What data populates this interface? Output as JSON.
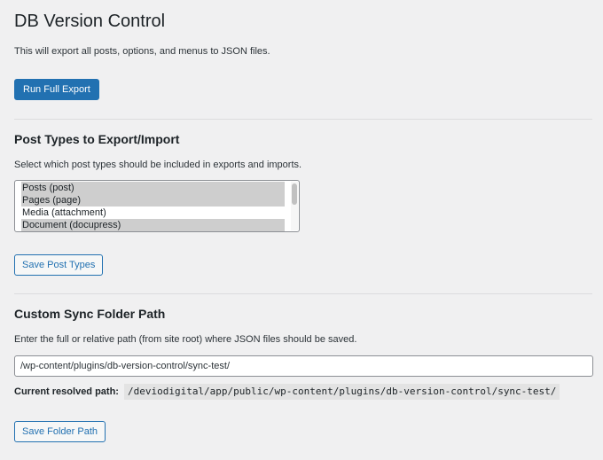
{
  "page": {
    "title": "DB Version Control"
  },
  "export": {
    "description": "This will export all posts, options, and menus to JSON files.",
    "button_label": "Run Full Export"
  },
  "post_types": {
    "heading": "Post Types to Export/Import",
    "description": "Select which post types should be included in exports and imports.",
    "options": [
      {
        "label": "Posts (post)",
        "selected": true
      },
      {
        "label": "Pages (page)",
        "selected": true
      },
      {
        "label": "Media (attachment)",
        "selected": false
      },
      {
        "label": "Document (docupress)",
        "selected": true
      }
    ],
    "save_label": "Save Post Types"
  },
  "sync_folder": {
    "heading": "Custom Sync Folder Path",
    "description": "Enter the full or relative path (from site root) where JSON files should be saved.",
    "input_value": "/wp-content/plugins/db-version-control/sync-test/",
    "resolved_label": "Current resolved path:",
    "resolved_path": "/deviodigital/app/public/wp-content/plugins/db-version-control/sync-test/",
    "save_label": "Save Folder Path"
  }
}
